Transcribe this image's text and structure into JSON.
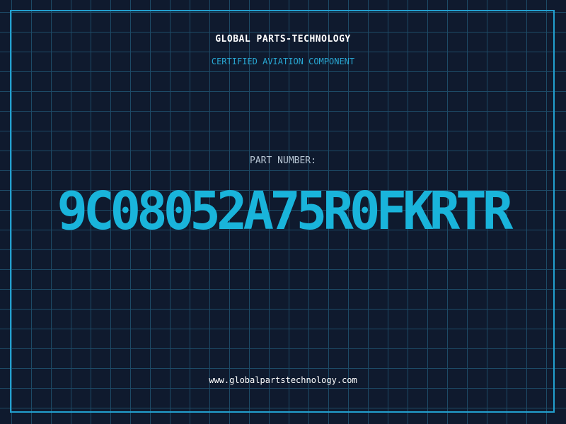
{
  "header": {
    "title": "GLOBAL PARTS-TECHNOLOGY",
    "subtitle": "CERTIFIED AVIATION COMPONENT"
  },
  "part": {
    "label": "PART NUMBER:",
    "number": "9C08052A75R0FKRTR"
  },
  "footer": {
    "url": "www.globalpartstechnology.com"
  },
  "colors": {
    "background": "#0f1a2e",
    "grid": "#1d4a66",
    "accent": "#19b4db",
    "frame": "#22a0cf"
  }
}
